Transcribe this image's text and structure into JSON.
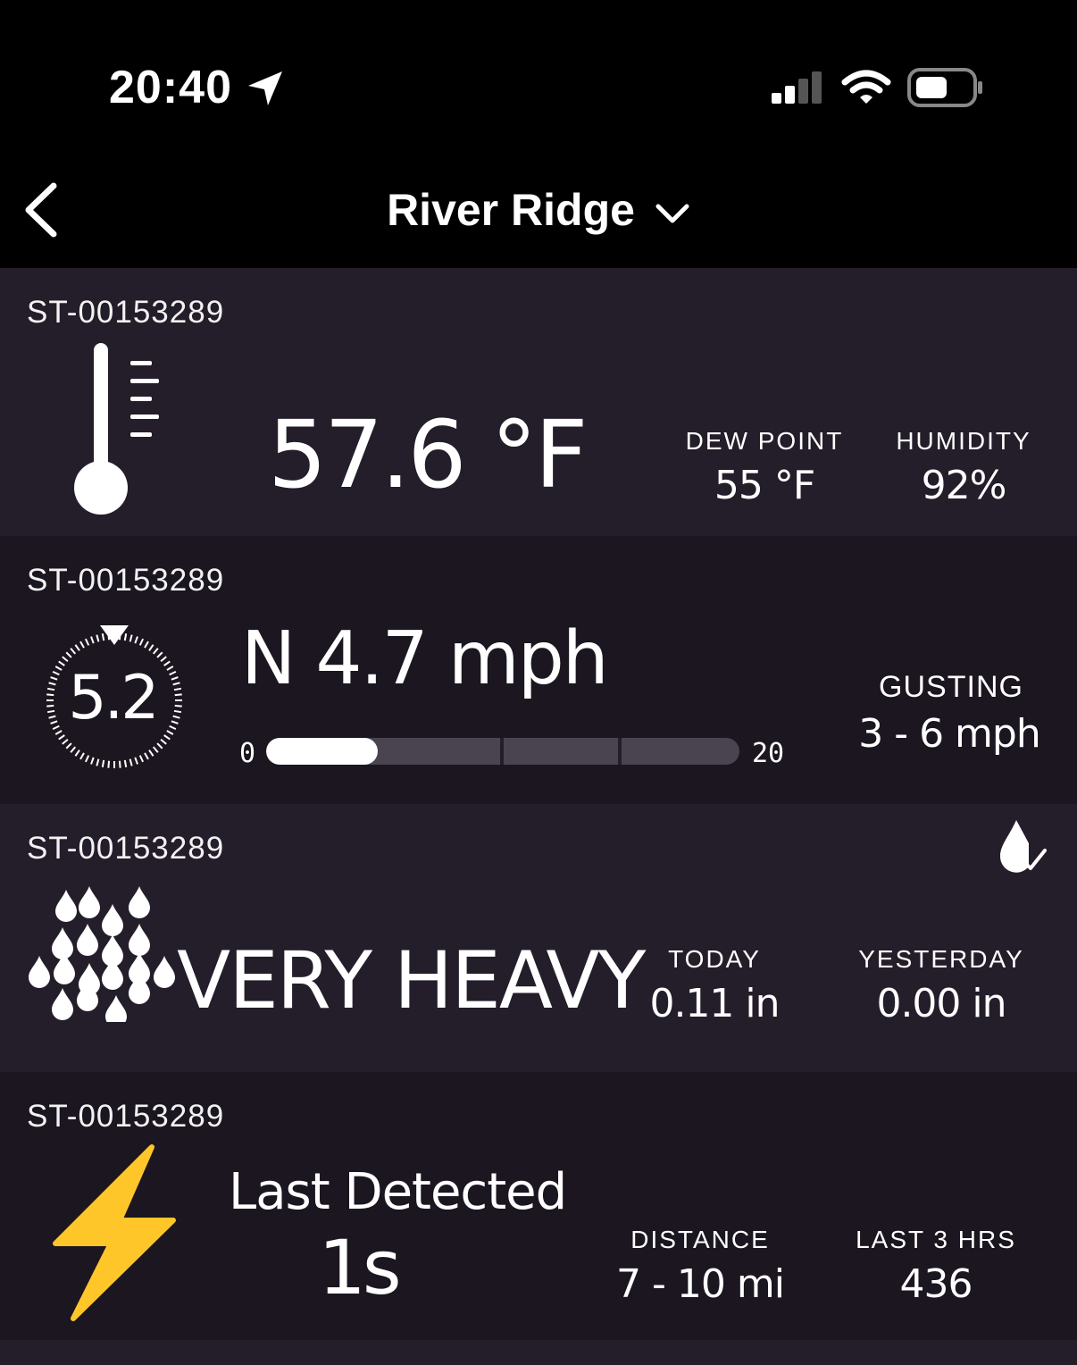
{
  "status_bar": {
    "time": "20:40",
    "icons": [
      "location-arrow-icon",
      "cellular-signal-icon",
      "wifi-icon",
      "battery-icon"
    ]
  },
  "nav": {
    "title": "River Ridge",
    "back_icon": "chevron-left-icon",
    "dropdown_icon": "chevron-down-icon"
  },
  "cards": {
    "temperature": {
      "station": "ST-00153289",
      "icon": "thermometer-icon",
      "value": "57.6 °F",
      "dew_point_label": "DEW POINT",
      "dew_point_value": "55 °F",
      "humidity_label": "HUMIDITY",
      "humidity_value": "92%"
    },
    "wind": {
      "station": "ST-00153289",
      "icon": "wind-dial-icon",
      "dial_value": "5.2",
      "value": "N 4.7 mph",
      "scale_min": "0",
      "scale_max": "20",
      "level": 4.7,
      "gusting_label": "GUSTING",
      "gusting_value": "3 - 6 mph"
    },
    "rain": {
      "station": "ST-00153289",
      "icon": "raindrops-icon",
      "badge_icon": "drop-check-icon",
      "intensity": "VERY HEAVY",
      "today_label": "TODAY",
      "today_value": "0.11 in",
      "yesterday_label": "YESTERDAY",
      "yesterday_value": "0.00 in"
    },
    "lightning": {
      "station": "ST-00153289",
      "icon": "lightning-bolt-icon",
      "last_detected_label": "Last Detected",
      "last_detected_value": "1s",
      "distance_label": "DISTANCE",
      "distance_value": "7 - 10 mi",
      "last3_label": "LAST 3 HRS",
      "last3_value": "436"
    }
  },
  "colors": {
    "card_a": "#241d2a",
    "card_b": "#1b1620",
    "lightning": "#ffc629"
  }
}
